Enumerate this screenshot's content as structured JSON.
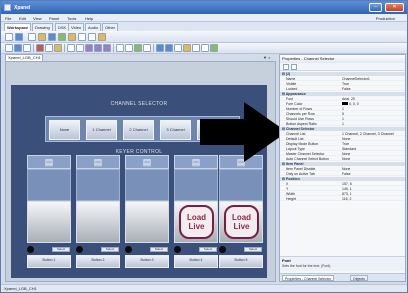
{
  "window": {
    "title": "Xpanel",
    "minimize_icon": "minimize-icon",
    "close_icon": "close-icon"
  },
  "menu": {
    "items": [
      "File",
      "Edit",
      "View",
      "Panel",
      "Tools",
      "Help"
    ],
    "right_label": "Production"
  },
  "ribbon_tabs": [
    "Workspace",
    "Drawing",
    "DSK",
    "Video",
    "Audio",
    "Other"
  ],
  "document_tab": "Xpanel_LGB_CH1",
  "canvas": {
    "channel_selector_title": "CHANNEL SELECTOR",
    "channel_buttons": [
      "None",
      "1 Channel",
      "2 Channel",
      "3 Channel",
      "4 Channel"
    ],
    "keyer_control_title": "KEYER CONTROL",
    "keyers": [
      {
        "icon": "monitor-icon",
        "load_live": "",
        "select": "Select",
        "button": "Button 1"
      },
      {
        "icon": "monitor-icon",
        "load_live": "",
        "select": "Select",
        "button": "Button 2"
      },
      {
        "icon": "monitor-icon",
        "load_live": "",
        "select": "Select",
        "button": "Button 3"
      },
      {
        "icon": "monitor-icon",
        "load_live": "Load Live",
        "select": "Select",
        "button": "Button 4"
      },
      {
        "icon": "monitor-icon",
        "load_live": "Load Live",
        "select": "Select",
        "button": "Button 5"
      }
    ]
  },
  "properties": {
    "title": "Properties - Channel Selector",
    "groups": [
      {
        "label": "(2)",
        "rows": [
          {
            "name": "Name",
            "value": "ChannelSelector1"
          },
          {
            "name": "Visible",
            "value": "True"
          },
          {
            "name": "Locked",
            "value": "False"
          }
        ]
      },
      {
        "label": "Appearance",
        "rows": [
          {
            "name": "Font",
            "value": "Arial, 20"
          },
          {
            "name": "Fore Color",
            "value": "0, 0, 0"
          },
          {
            "name": "Number of Rows",
            "value": "1"
          },
          {
            "name": "Channels per Row",
            "value": "5"
          },
          {
            "name": "Should Use Rows",
            "value": "1"
          },
          {
            "name": "Button Aspect Ratio",
            "value": "1"
          }
        ]
      },
      {
        "label": "Channel Selector",
        "rows": [
          {
            "name": "Channel List",
            "value": "1 Channel, 2 Channel, 3 Channel"
          },
          {
            "name": "Default List",
            "value": "None"
          },
          {
            "name": "Display Mode Button",
            "value": "True"
          },
          {
            "name": "Layout Type",
            "value": "Standard"
          },
          {
            "name": "Master Channel Selector",
            "value": "None"
          },
          {
            "name": "Auto Channel Select Button",
            "value": "None"
          }
        ]
      },
      {
        "label": "Item Panel",
        "rows": [
          {
            "name": "Item Panel Disable",
            "value": "None"
          },
          {
            "name": "Only on Active Tab",
            "value": "False"
          }
        ]
      },
      {
        "label": "Position",
        "rows": [
          {
            "name": "X",
            "value": "157, 6"
          },
          {
            "name": "Y",
            "value": "145, 1"
          },
          {
            "name": "Width",
            "value": "873, 1"
          },
          {
            "name": "Height",
            "value": "116, 2"
          }
        ]
      }
    ],
    "description_title": "Font",
    "description_text": "Sets the font for the text. (Font)",
    "bottom_tabs": [
      "Properties - Channel Selector",
      "Objects"
    ]
  },
  "statusbar": "Xpanel_LGB_CH1",
  "colors": {
    "accent": "#2f63b4",
    "canvas": "#3a4f79",
    "load_live": "#7c1d42"
  }
}
